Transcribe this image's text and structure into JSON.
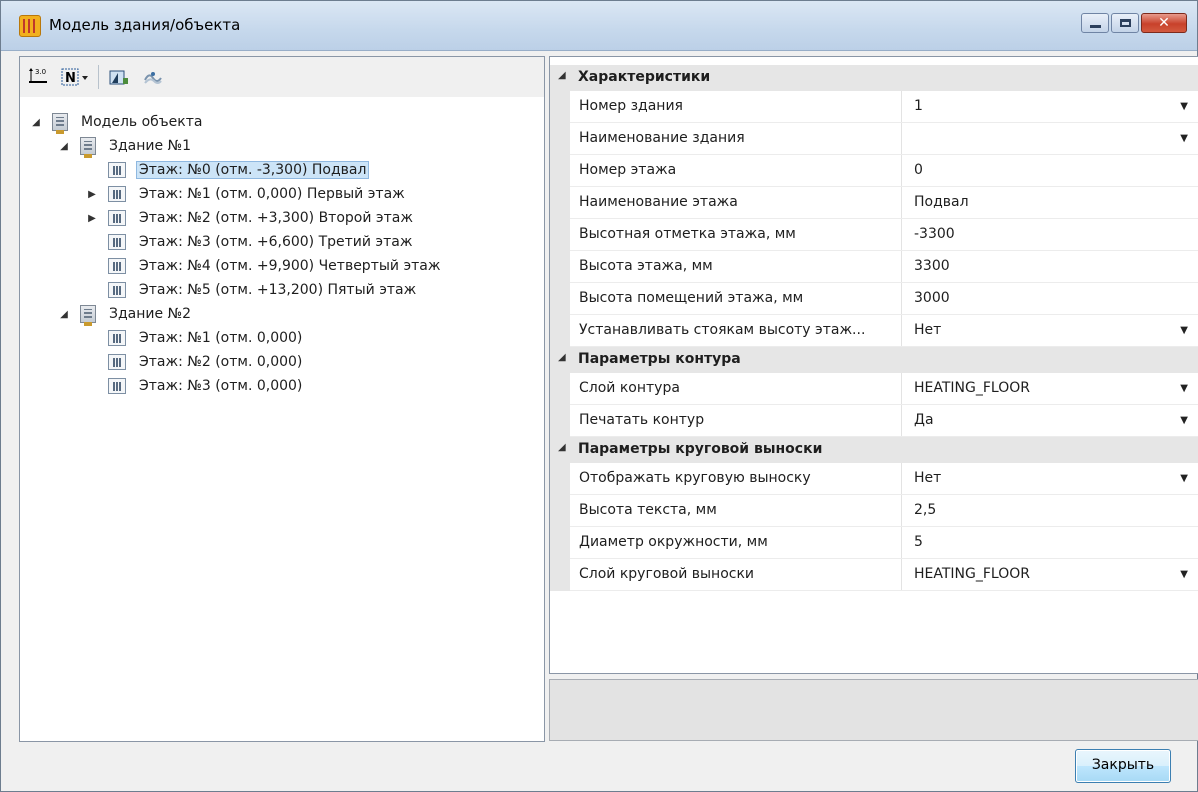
{
  "window": {
    "title": "Модель здания/объекта",
    "close_glyph": "✕"
  },
  "toolbar": {
    "icons": [
      "elevation-icon",
      "numbering-dropdown-icon",
      "building-view-icon",
      "wave-icon"
    ]
  },
  "tree": {
    "root": "Модель объекта",
    "building1": "Здание №1",
    "b1_floors": [
      "Этаж: №0 (отм. -3,300) Подвал",
      "Этаж: №1 (отм. 0,000) Первый этаж",
      "Этаж: №2 (отм. +3,300) Второй этаж",
      "Этаж: №3 (отм. +6,600) Третий этаж",
      "Этаж: №4 (отм. +9,900) Четвертый этаж",
      "Этаж: №5 (отм. +13,200) Пятый этаж"
    ],
    "building2": "Здание №2",
    "b2_floors": [
      "Этаж: №1 (отм. 0,000)",
      "Этаж: №2 (отм. 0,000)",
      "Этаж: №3 (отм. 0,000)"
    ],
    "selected": "Этаж: №0 (отм. -3,300) Подвал"
  },
  "props": {
    "cat1": "Характеристики",
    "cat2": "Параметры контура",
    "cat3": "Параметры круговой выноски",
    "rows": [
      {
        "name": "Номер здания",
        "value": "1",
        "dropdown": true
      },
      {
        "name": "Наименование здания",
        "value": "",
        "dropdown": true
      },
      {
        "name": "Номер этажа",
        "value": "0",
        "dropdown": false
      },
      {
        "name": "Наименование этажа",
        "value": "Подвал",
        "dropdown": false
      },
      {
        "name": "Высотная отметка этажа, мм",
        "value": "-3300",
        "dropdown": false
      },
      {
        "name": "Высота этажа, мм",
        "value": "3300",
        "dropdown": false
      },
      {
        "name": "Высота помещений этажа, мм",
        "value": "3000",
        "dropdown": false
      },
      {
        "name": "Устанавливать стоякам высоту этаж...",
        "value": "Нет",
        "dropdown": true
      },
      {
        "name": "Слой контура",
        "value": "HEATING_FLOOR",
        "dropdown": true
      },
      {
        "name": "Печатать контур",
        "value": "Да",
        "dropdown": true
      },
      {
        "name": "Отображать круговую выноску",
        "value": "Нет",
        "dropdown": true
      },
      {
        "name": "Высота текста, мм",
        "value": "2,5",
        "dropdown": false
      },
      {
        "name": "Диаметр окружности, мм",
        "value": "5",
        "dropdown": false
      },
      {
        "name": "Слой круговой выноски",
        "value": "HEATING_FLOOR",
        "dropdown": true
      }
    ],
    "dropdown_glyph": "▼",
    "category_glyph": "◢"
  },
  "footer": {
    "close_label": "Закрыть"
  }
}
